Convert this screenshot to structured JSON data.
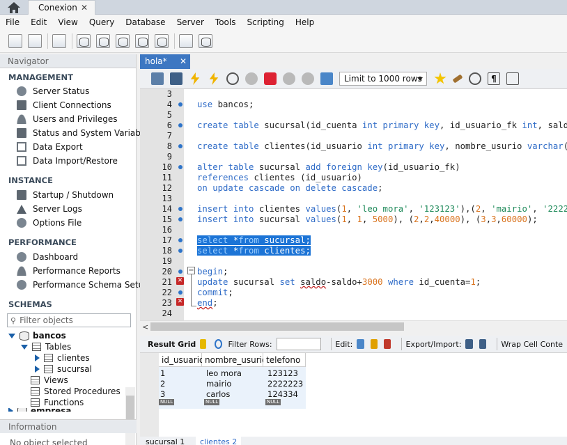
{
  "window": {
    "connection_tab": "Conexion",
    "close_symbol": "✕"
  },
  "menu": [
    "File",
    "Edit",
    "View",
    "Query",
    "Database",
    "Server",
    "Tools",
    "Scripting",
    "Help"
  ],
  "navigator": {
    "title": "Navigator",
    "management": {
      "title": "MANAGEMENT",
      "items": [
        "Server Status",
        "Client Connections",
        "Users and Privileges",
        "Status and System Variables",
        "Data Export",
        "Data Import/Restore"
      ]
    },
    "instance": {
      "title": "INSTANCE",
      "items": [
        "Startup / Shutdown",
        "Server Logs",
        "Options File"
      ]
    },
    "performance": {
      "title": "PERFORMANCE",
      "items": [
        "Dashboard",
        "Performance Reports",
        "Performance Schema Setup"
      ]
    },
    "schemas": {
      "title": "SCHEMAS",
      "filter_placeholder": "Filter objects",
      "tree": {
        "db": "bancos",
        "tables": "Tables",
        "table_items": [
          "clientes",
          "sucursal"
        ],
        "views": "Views",
        "procs": "Stored Procedures",
        "funcs": "Functions",
        "next_db": "empresa"
      }
    },
    "information": {
      "title": "Information",
      "body": "No object selected"
    }
  },
  "editor": {
    "tab_label": "hola*",
    "limit": "Limit to 1000 rows",
    "line_numbers": [
      "3",
      "4",
      "5",
      "6",
      "7",
      "8",
      "9",
      "10",
      "11",
      "12",
      "13",
      "14",
      "15",
      "16",
      "17",
      "18",
      "19",
      "20",
      "21",
      "22",
      "23",
      "24"
    ]
  },
  "results": {
    "result_grid": "Result Grid",
    "filter_rows": "Filter Rows:",
    "edit": "Edit:",
    "export_import": "Export/Import:",
    "wrap": "Wrap Cell Conte",
    "columns": [
      "id_usuario",
      "nombre_usurio",
      "telefono"
    ],
    "rows": [
      [
        "1",
        "leo mora",
        "123123"
      ],
      [
        "2",
        "mairio",
        "2222223"
      ],
      [
        "3",
        "carlos",
        "124334"
      ]
    ],
    "null_label": "NULL"
  },
  "bottom_tabs": [
    "sucursal 1",
    "clientes 2"
  ]
}
